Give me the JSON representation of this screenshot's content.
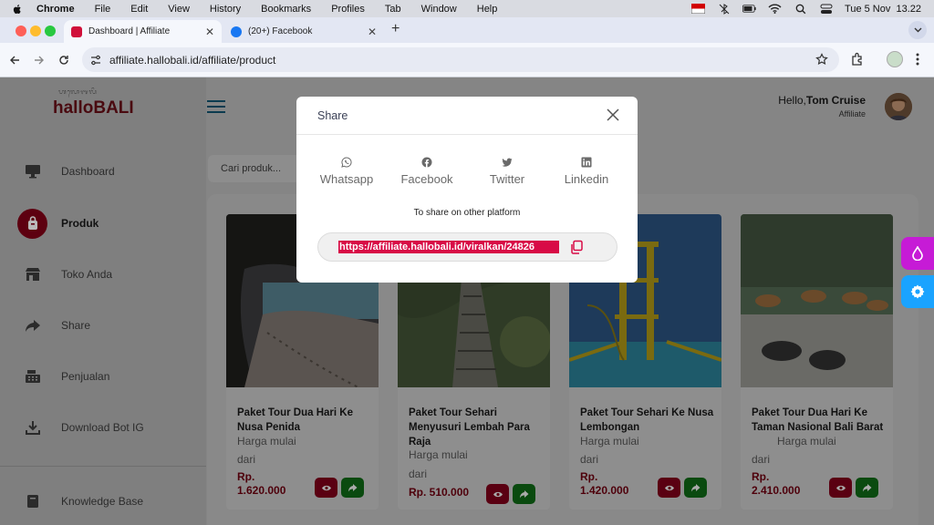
{
  "menubar": {
    "app": "Chrome",
    "items": [
      "File",
      "Edit",
      "View",
      "History",
      "Bookmarks",
      "Profiles",
      "Tab",
      "Window",
      "Help"
    ],
    "clock": "Tue 5 Nov  13.22"
  },
  "tabs": [
    {
      "title": "Dashboard | Affiliate",
      "favicon_color": "#d0103a"
    },
    {
      "title": "(20+) Facebook",
      "favicon_color": "#1877f2"
    }
  ],
  "toolbar": {
    "url": "affiliate.hallobali.id/affiliate/product"
  },
  "sidebar": {
    "logo_sub": "ᬳᬮᭀᬩᬮᬶ",
    "logo_main": "hallo",
    "logo_accent": "BALI",
    "items": [
      {
        "label": "Dashboard",
        "icon": "monitor-icon"
      },
      {
        "label": "Produk",
        "icon": "bag-icon",
        "active": true
      },
      {
        "label": "Toko Anda",
        "icon": "store-icon"
      },
      {
        "label": "Share",
        "icon": "share-arrow-icon"
      },
      {
        "label": "Penjualan",
        "icon": "cash-register-icon"
      },
      {
        "label": "Download Bot IG",
        "icon": "download-icon"
      },
      {
        "label": "Knowledge Base",
        "icon": "book-icon"
      }
    ]
  },
  "header": {
    "hello": "Hello,",
    "user": "Tom Cruise",
    "role": "Affiliate"
  },
  "search": {
    "placeholder": "Cari produk..."
  },
  "products": [
    {
      "title": "Paket Tour Dua Hari Ke Nusa Penida",
      "from_label": "Harga mulai",
      "from_suffix": "dari",
      "price": "Rp. 1.620.000"
    },
    {
      "title": "Paket Tour Sehari Menyusuri Lembah Para Raja",
      "from_label": "Harga mulai",
      "from_suffix": "dari",
      "price": "Rp. 510.000"
    },
    {
      "title": "Paket Tour Sehari Ke Nusa Lembongan",
      "from_label": "Harga mulai",
      "from_suffix": "dari",
      "price": "Rp. 1.420.000"
    },
    {
      "title": "Paket Tour Dua Hari Ke Taman Nasional Bali Barat",
      "from_label": "Harga mulai",
      "from_suffix": "dari",
      "price": "Rp. 2.410.000"
    }
  ],
  "modal": {
    "title": "Share",
    "socials": [
      {
        "label": "Whatsapp",
        "icon": "whatsapp-icon"
      },
      {
        "label": "Facebook",
        "icon": "facebook-icon"
      },
      {
        "label": "Twitter",
        "icon": "twitter-icon"
      },
      {
        "label": "Linkedin",
        "icon": "linkedin-icon"
      }
    ],
    "other_platform": "To share on other platform",
    "link": "https://affiliate.hallobali.id/viralkan/24826"
  },
  "colors": {
    "brand": "#d0103a",
    "share_green": "#128c1e",
    "accent_magenta": "#c61bd6",
    "accent_blue": "#1aa3ff"
  }
}
